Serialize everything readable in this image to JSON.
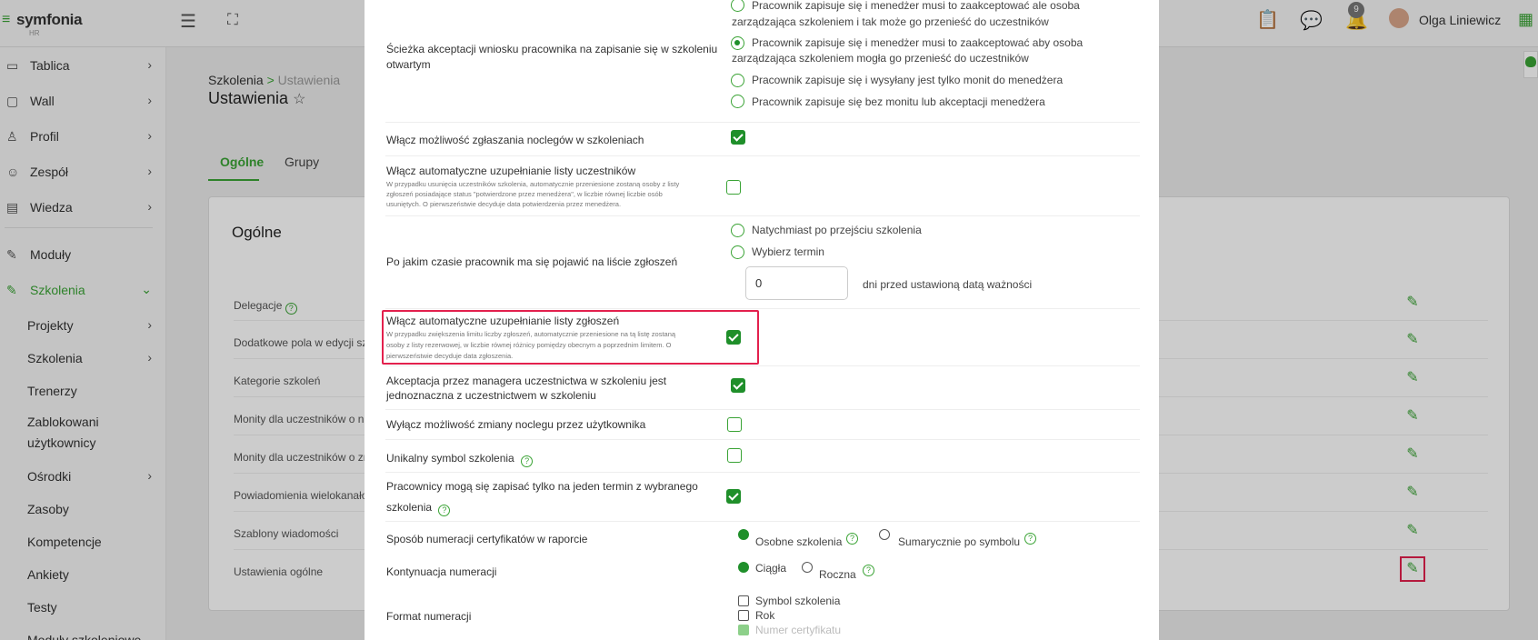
{
  "app": {
    "logo_name": "symfonia",
    "logo_sub": "HR",
    "bell_count": "9",
    "user_name": "Olga Liniewicz"
  },
  "sidebar": {
    "items": [
      {
        "label": "Tablica"
      },
      {
        "label": "Wall"
      },
      {
        "label": "Profil"
      },
      {
        "label": "Zespół"
      },
      {
        "label": "Wiedza"
      },
      {
        "label": "Moduły"
      },
      {
        "label": "Szkolenia"
      }
    ],
    "sub": [
      {
        "label": "Projekty"
      },
      {
        "label": "Szkolenia"
      },
      {
        "label": "Trenerzy"
      },
      {
        "label": "Zablokowani"
      },
      {
        "label": "użytkownicy"
      },
      {
        "label": "Ośrodki"
      },
      {
        "label": "Zasoby"
      },
      {
        "label": "Kompetencje"
      },
      {
        "label": "Ankiety"
      },
      {
        "label": "Testy"
      },
      {
        "label": "Moduły szkoleniowe"
      }
    ]
  },
  "page": {
    "breadcrumb_root": "Szkolenia",
    "breadcrumb_sep": ">",
    "breadcrumb_current": "Ustawienia",
    "title": "Ustawienia",
    "tabs": [
      {
        "label": "Ogólne"
      },
      {
        "label": "Grupy"
      }
    ],
    "card_title": "Ogólne",
    "rows": [
      {
        "label": "Delegacje"
      },
      {
        "label": "Dodatkowe pola w edycji sz"
      },
      {
        "label": "Kategorie szkoleń"
      },
      {
        "label": "Monity dla uczestników o n"
      },
      {
        "label": "Monity dla uczestników o zr"
      },
      {
        "label": "Powiadomienia wielokanało"
      },
      {
        "label": "Szablony wiadomości"
      },
      {
        "label": "Ustawienia ogólne"
      }
    ]
  },
  "modal": {
    "path_label_1": "Ścieżka akceptacji wniosku pracownika na zapisanie się w szkoleniu",
    "path_label_2": "otwartym",
    "path_opt1a": "Pracownik zapisuje się i menedżer musi to zaakceptować ale osoba",
    "path_opt1b": "zarządzająca szkoleniem i tak może go przenieść do uczestników",
    "path_opt2a": "Pracownik zapisuje się i menedżer musi to zaakceptować aby osoba",
    "path_opt2b": "zarządzająca szkoleniem mogła go przenieść do uczestników",
    "path_opt3": "Pracownik zapisuje się i wysyłany jest tylko monit do menedżera",
    "path_opt4": "Pracownik zapisuje się bez monitu lub akceptacji menedżera",
    "lodging_label": "Włącz możliwość zgłaszania noclegów w szkoleniach",
    "auto_participants_label": "Włącz automatyczne uzupełnianie listy uczestników",
    "auto_participants_desc_1": "W przypadku usunięcia uczestników szkolenia, automatycznie przeniesione zostaną osoby z listy",
    "auto_participants_desc_2": "zgłoszeń posiadające status \"potwierdzone przez menedżera\", w liczbie równej liczbie osób",
    "auto_participants_desc_3": "usuniętych. O pierwszeństwie decyduje data potwierdzenia przez menedżera.",
    "time_label": "Po jakim czasie pracownik ma się pojawić na liście zgłoszeń",
    "time_opt1": "Natychmiast po przejściu szkolenia",
    "time_opt2": "Wybierz termin",
    "days_value": "0",
    "days_suffix": "dni przed ustawioną datą ważności",
    "auto_requests_label": "Włącz automatyczne uzupełnianie listy zgłoszeń",
    "auto_requests_desc_1": "W przypadku zwiększenia limitu liczby zgłoszeń, automatycznie przeniesione na tą listę zostaną",
    "auto_requests_desc_2": "osoby z listy rezerwowej, w liczbie równej różnicy pomiędzy obecnym a poprzednim limitem. O",
    "auto_requests_desc_3": "pierwszeństwie decyduje data zgłoszenia.",
    "manager_accept_1": "Akceptacja przez managera uczestnictwa w szkoleniu jest",
    "manager_accept_2": "jednoznaczna z uczestnictwem w szkoleniu",
    "disable_lodging": "Wyłącz możliwość zmiany noclegu przez użytkownika",
    "unique_symbol": "Unikalny symbol szkolenia",
    "one_term_1": "Pracownicy mogą się zapisać tylko na jeden termin z wybranego",
    "one_term_2": "szkolenia",
    "numbering_label": "Sposób numeracji certyfikatów w raporcie",
    "numbering_opt1": "Osobne szkolenia",
    "numbering_opt2": "Sumarycznie po symbolu",
    "continuation_label": "Kontynuacja numeracji",
    "continuation_opt1": "Ciągła",
    "continuation_opt2": "Roczna",
    "format_label": "Format numeracji",
    "format_opt1": "Symbol szkolenia",
    "format_opt2": "Rok",
    "format_opt3": "Numer certyfikatu"
  }
}
